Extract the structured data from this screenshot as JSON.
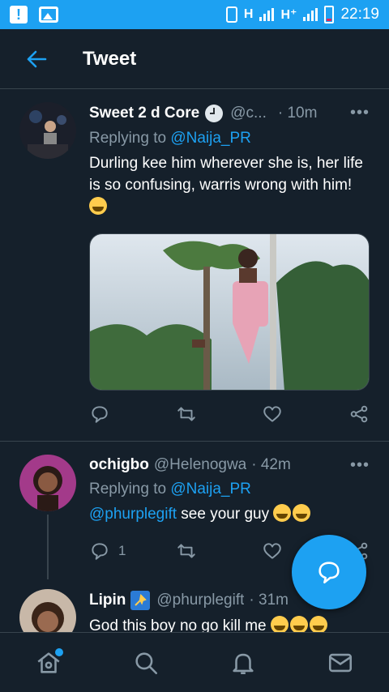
{
  "status_bar": {
    "network1": "H",
    "network2": "H⁺",
    "time": "22:19"
  },
  "header": {
    "title": "Tweet"
  },
  "main_tweet": {
    "name": "Sweet 2 d Core",
    "handle": "@c...",
    "time": "· 10m",
    "replying_prefix": "Replying to ",
    "replying_to": "@Naija_PR",
    "text": "Durling kee him wherever she is, her life is so confusing, warris wrong with him!"
  },
  "reply1": {
    "name": "ochigbo",
    "handle": "@Helenogwa",
    "time": "· 42m",
    "replying_prefix": "Replying to ",
    "replying_to": "@Naija_PR",
    "mention": "@phurplegift",
    "text": " see your guy ",
    "reply_count": "1"
  },
  "reply2": {
    "name": "Lipin",
    "handle": "@phurplegift",
    "time": "· 31m",
    "text": "God this boy no go kill me "
  },
  "colors": {
    "accent": "#1da1f2",
    "background": "#15202b",
    "muted": "#8899a6"
  }
}
